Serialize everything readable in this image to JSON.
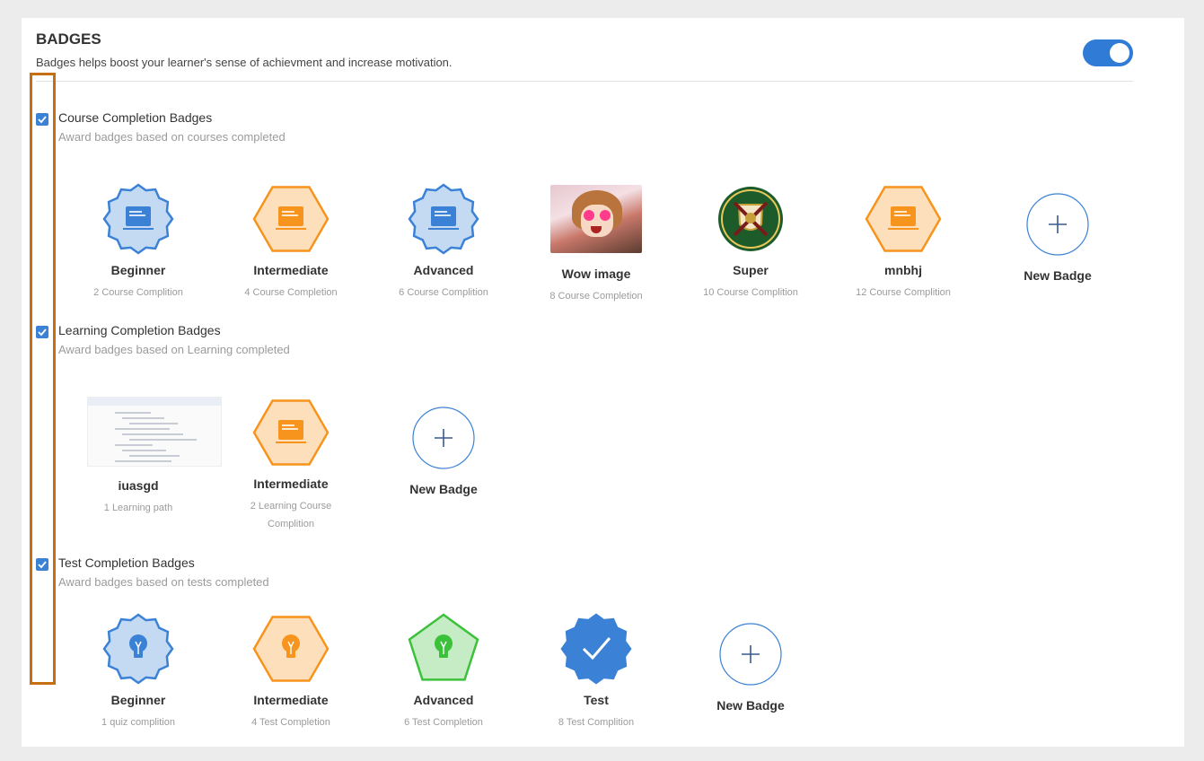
{
  "header": {
    "title": "BADGES",
    "subtitle": "Badges helps boost your learner's sense of achievment and increase motivation."
  },
  "toggle": {
    "enabled": true
  },
  "sections": [
    {
      "title": "Course Completion Badges",
      "description": "Award badges based on courses completed",
      "checked": true,
      "badges": [
        {
          "name": "Beginner",
          "count": "2 Course Complition",
          "icon": "monitor-icon",
          "shape": "star",
          "color": "#3b82d6"
        },
        {
          "name": "Intermediate",
          "count": "4 Course Completion",
          "icon": "monitor-icon",
          "shape": "hexagon",
          "color": "#f7941d"
        },
        {
          "name": "Advanced",
          "count": "6 Course Complition",
          "icon": "monitor-icon",
          "shape": "star",
          "color": "#3b82d6"
        },
        {
          "name": "Wow image",
          "count": "8 Course Completion",
          "icon": "anime-photo",
          "shape": "photo"
        },
        {
          "name": "Super",
          "count": "10 Course Complition",
          "icon": "emblem-icon",
          "shape": "emblem"
        },
        {
          "name": "mnbhj",
          "count": "12 Course Complition",
          "icon": "monitor-icon",
          "shape": "hexagon",
          "color": "#f7941d"
        }
      ],
      "new_badge_label": "New Badge"
    },
    {
      "title": "Learning Completion Badges",
      "description": "Award badges based on Learning completed",
      "checked": true,
      "badges": [
        {
          "name": "iuasgd",
          "count": "1 Learning path",
          "icon": "screenshot-thumbnail",
          "shape": "screenshot"
        },
        {
          "name": "Intermediate",
          "count": "2 Learning Course Complition",
          "icon": "monitor-icon",
          "shape": "hexagon",
          "color": "#f7941d"
        }
      ],
      "new_badge_label": "New Badge"
    },
    {
      "title": "Test Completion Badges",
      "description": "Award badges based on tests completed",
      "checked": true,
      "badges": [
        {
          "name": "Beginner",
          "count": "1 quiz complition",
          "icon": "lightbulb-icon",
          "shape": "star",
          "color": "#3b82d6"
        },
        {
          "name": "Intermediate",
          "count": "4 Test Completion",
          "icon": "lightbulb-icon",
          "shape": "hexagon",
          "color": "#f7941d"
        },
        {
          "name": "Advanced",
          "count": "6 Test Completion",
          "icon": "lightbulb-icon",
          "shape": "pentagon",
          "color": "#3cc13b"
        },
        {
          "name": "Test",
          "count": "8 Test Complition",
          "icon": "checkmark-icon",
          "shape": "star-solid",
          "color": "#3b82d6"
        }
      ],
      "new_badge_label": "New Badge"
    }
  ]
}
